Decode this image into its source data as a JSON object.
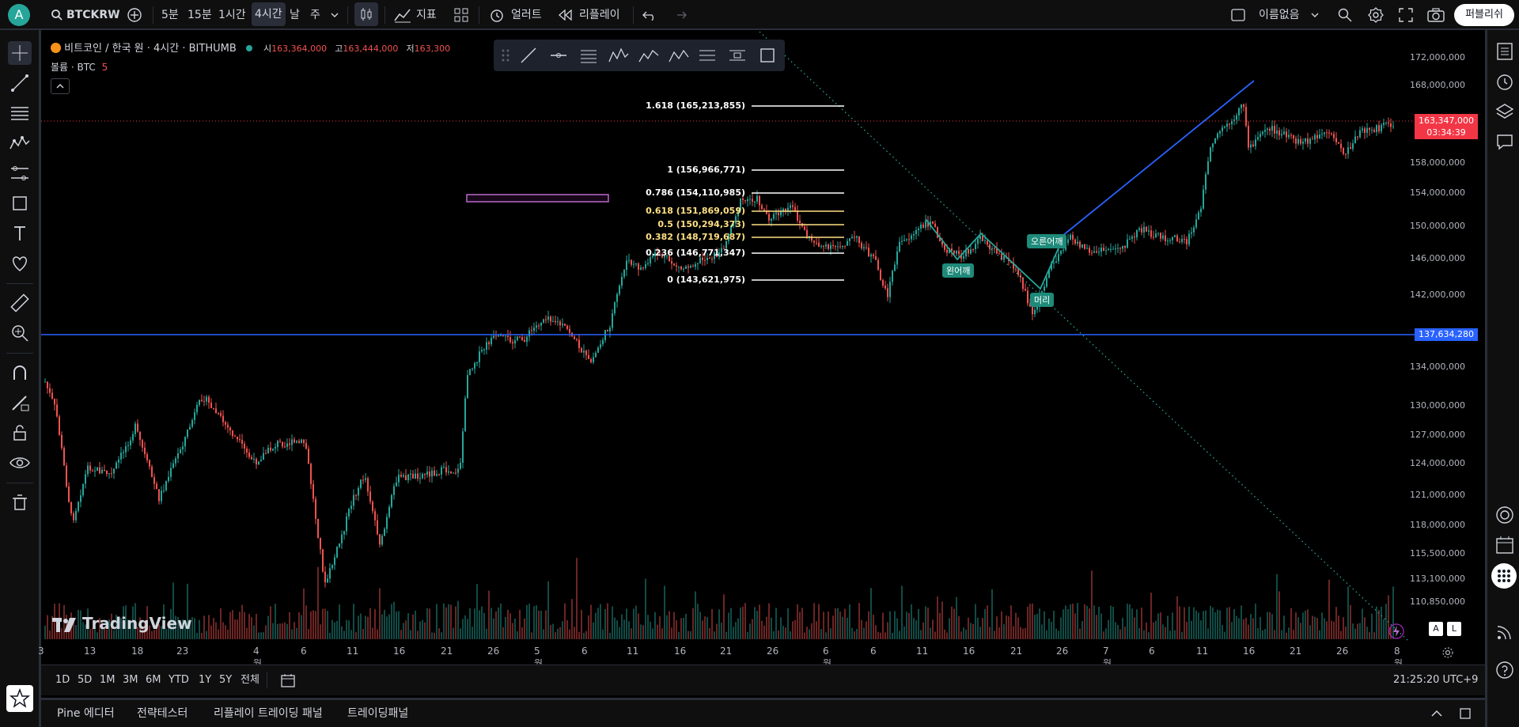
{
  "topbar": {
    "avatar_letter": "A",
    "symbol": "BTCKRW",
    "intervals": [
      "5분",
      "15분",
      "1시간",
      "4시간",
      "날",
      "주"
    ],
    "active_interval": "4시간",
    "indicators_label": "지표",
    "alert_label": "얼러트",
    "replay_label": "리플레이",
    "layout_name": "이름없음",
    "publish_label": "퍼블리쉬"
  },
  "legend": {
    "title": "비트코인 / 한국 원 · 4시간 · BITHUMB",
    "open_label": "시",
    "open_value": "163,364,000",
    "high_label": "고",
    "high_value": "163,444,000",
    "low_label": "저",
    "low_value": "163,300",
    "volume_label": "볼륨 · BTC",
    "volume_value": "5"
  },
  "price_axis": {
    "labels": [
      "172,000,000",
      "168,000,000",
      "158,000,000",
      "154,000,000",
      "150,000,000",
      "146,000,000",
      "142,000,000",
      "134,000,000",
      "130,000,000",
      "127,000,000",
      "124,000,000",
      "121,000,000",
      "118,000,000",
      "115,500,000",
      "113,100,000",
      "110,850,000"
    ],
    "current_price": "163,347,000",
    "countdown": "03:34:39",
    "hline_price": "137,634,280"
  },
  "time_axis": {
    "labels": [
      "3",
      "13",
      "18",
      "23",
      "4월",
      "6",
      "11",
      "16",
      "21",
      "26",
      "5월",
      "6",
      "11",
      "16",
      "21",
      "26",
      "6월",
      "6",
      "11",
      "16",
      "21",
      "26",
      "7월",
      "6",
      "11",
      "16",
      "21",
      "26",
      "8월"
    ]
  },
  "fib": [
    {
      "label": "1.618 (165,213,855)",
      "color": "#ffffff"
    },
    {
      "label": "1 (156,966,771)",
      "color": "#ffffff"
    },
    {
      "label": "0.786 (154,110,985)",
      "color": "#ffffff"
    },
    {
      "label": "0.618 (151,869,059)",
      "color": "#ffe082"
    },
    {
      "label": "0.5 (150,294,373)",
      "color": "#ffe082"
    },
    {
      "label": "0.382 (148,719,687)",
      "color": "#ffe082"
    },
    {
      "label": "0.236 (146,771,347)",
      "color": "#ffffff"
    },
    {
      "label": "0 (143,621,975)",
      "color": "#ffffff"
    }
  ],
  "annotations": {
    "left_shoulder": "왼어깨",
    "head": "머리",
    "right_shoulder": "오른어깨"
  },
  "watermark": "TradingView",
  "scale_buttons": [
    "A",
    "L"
  ],
  "bottombar": {
    "ranges": [
      "1D",
      "5D",
      "1M",
      "3M",
      "6M",
      "YTD",
      "1Y",
      "5Y",
      "전체"
    ],
    "clock": "21:25:20 UTC+9"
  },
  "panelbar": {
    "tabs": [
      "Pine 에디터",
      "전략테스터",
      "리플레이 트레이딩 패널",
      "트레이딩패널"
    ]
  },
  "colors": {
    "up": "#26a69a",
    "down": "#ef5350",
    "accent": "#2962ff",
    "current_price": "#f23645"
  }
}
